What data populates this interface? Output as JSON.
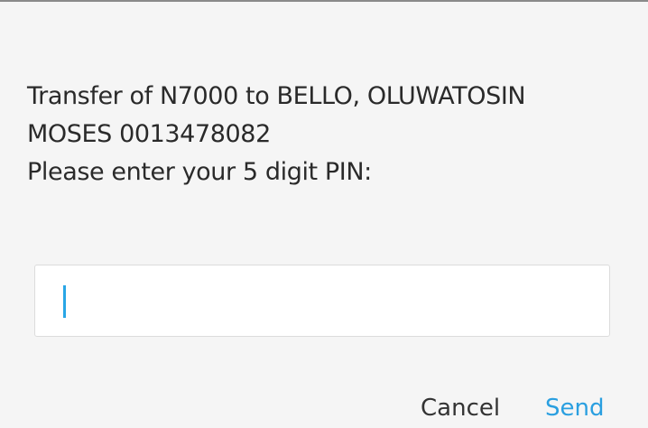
{
  "dialog": {
    "message_lines": [
      "Transfer of N7000 to BELLO, OLUWATOSIN",
      "MOSES 0013478082",
      "Please enter your 5 digit PIN:"
    ],
    "pin_input": {
      "value": "",
      "placeholder": ""
    },
    "buttons": {
      "cancel_label": "Cancel",
      "send_label": "Send"
    }
  },
  "colors": {
    "accent": "#2a9fe0",
    "caret": "#29a6e6",
    "text": "#2a2a2a",
    "background": "#f5f5f5"
  }
}
